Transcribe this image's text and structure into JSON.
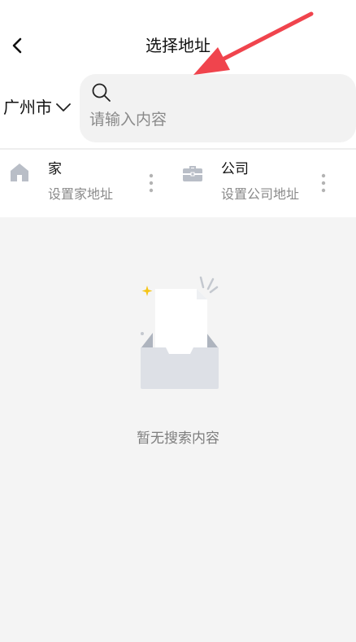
{
  "header": {
    "title": "选择地址",
    "back_icon": "chevron-left-icon"
  },
  "city_selector": {
    "label": "广州市",
    "icon": "chevron-down-icon"
  },
  "search": {
    "icon": "search-icon",
    "placeholder": "请输入内容",
    "value": ""
  },
  "quick_addresses": [
    {
      "title": "家",
      "subtitle": "设置家地址",
      "icon": "home-icon",
      "more_icon": "more-vertical-icon"
    },
    {
      "title": "公司",
      "subtitle": "设置公司地址",
      "icon": "briefcase-icon",
      "more_icon": "more-vertical-icon"
    }
  ],
  "empty_state": {
    "illustration": "empty-inbox-illustration",
    "text": "暂无搜索内容"
  },
  "colors": {
    "background": "#f4f4f4",
    "surface": "#ffffff",
    "search_bg": "#f2f2f2",
    "icon_gray": "#b7bcc5",
    "annotation_arrow": "#f0444d",
    "sparkle": "#f5c518"
  }
}
